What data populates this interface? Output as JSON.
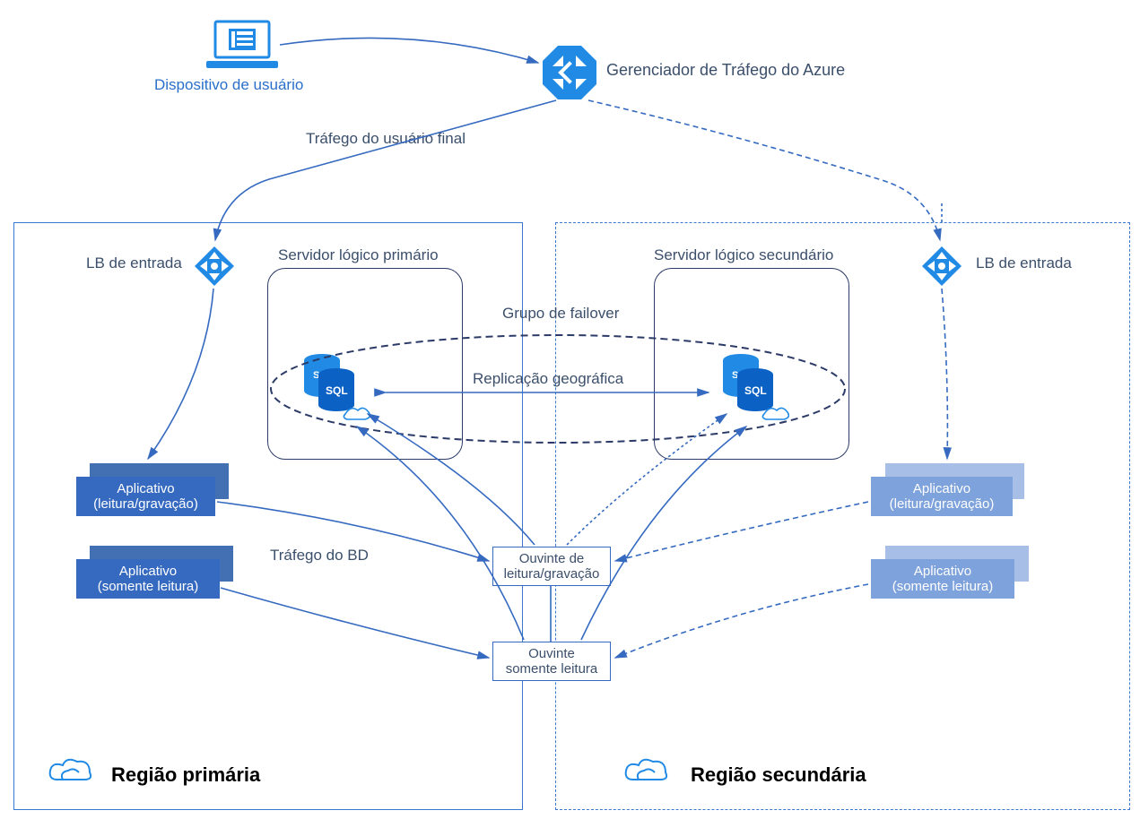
{
  "top": {
    "user_device": "Dispositivo de usuário",
    "traffic_manager": "Gerenciador de Tráfego do Azure",
    "end_user_traffic": "Tráfego do usuário final"
  },
  "primary": {
    "lb": "LB de entrada",
    "server": "Servidor lógico primário",
    "app_rw_line1": "Aplicativo",
    "app_rw_line2": "(leitura/gravação)",
    "app_ro_line1": "Aplicativo",
    "app_ro_line2": "(somente leitura)",
    "db_traffic": "Tráfego do BD",
    "region": "Região primária"
  },
  "secondary": {
    "lb": "LB de entrada",
    "server": "Servidor lógico secundário",
    "app_rw_line1": "Aplicativo",
    "app_rw_line2": "(leitura/gravação)",
    "app_ro_line1": "Aplicativo",
    "app_ro_line2": "(somente leitura)",
    "region": "Região secundária"
  },
  "center": {
    "failover_group": "Grupo de failover",
    "geo_replication": "Replicação geográfica",
    "listener_rw": "Ouvinte de\nleitura/gravação",
    "listener_ro": "Ouvinte\nsomente leitura"
  },
  "colors": {
    "azure": "#208ae5",
    "line": "#356ac0",
    "dark": "#2b3a67",
    "faded": "#7ea2db"
  }
}
